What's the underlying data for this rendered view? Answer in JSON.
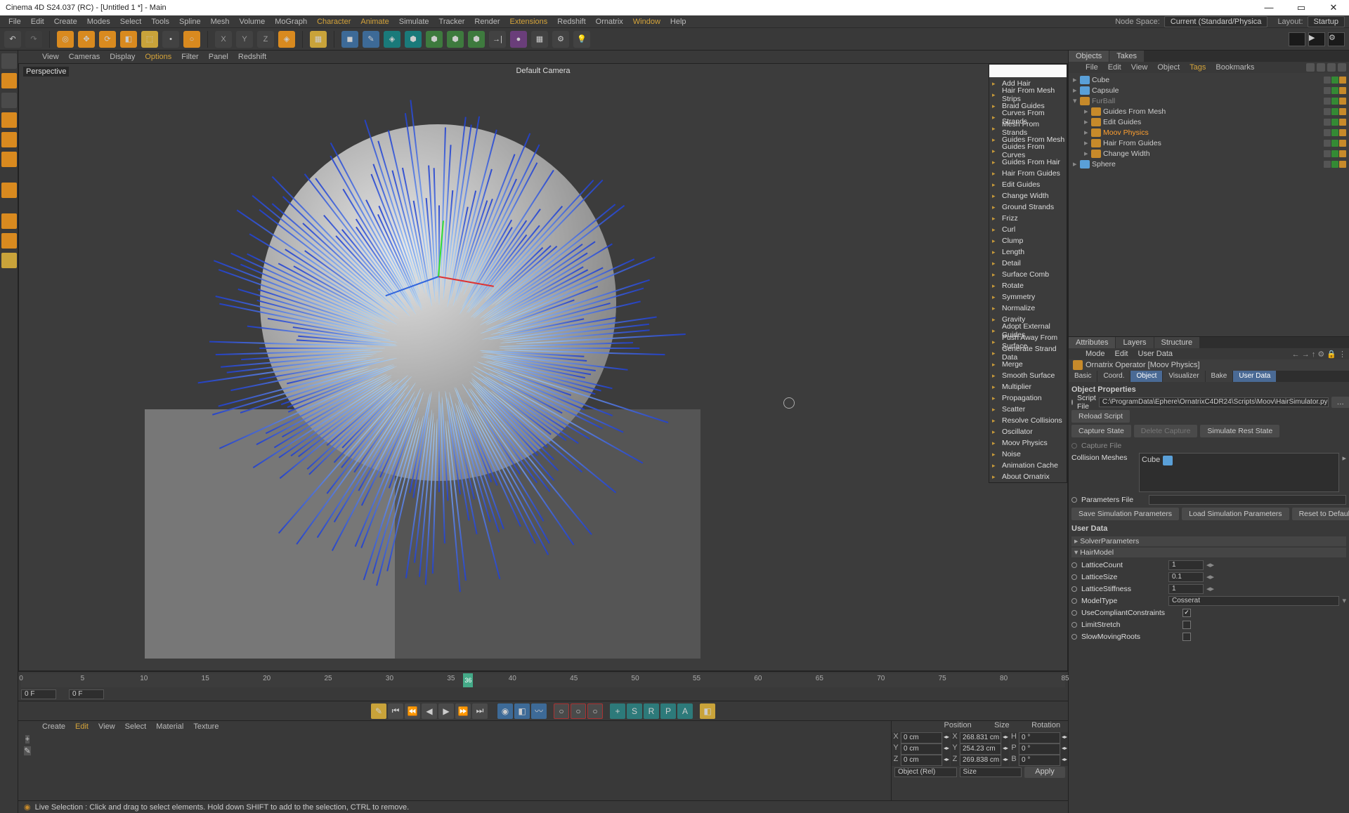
{
  "title": "Cinema 4D S24.037 (RC) - [Untitled 1 *] - Main",
  "menubar": [
    "File",
    "Edit",
    "Create",
    "Modes",
    "Select",
    "Tools",
    "Spline",
    "Mesh",
    "Volume",
    "MoGraph",
    "Character",
    "Animate",
    "Simulate",
    "Tracker",
    "Render",
    "Extensions",
    "Redshift",
    "Ornatrix",
    "Window",
    "Help"
  ],
  "menubar_hi1": [
    "Character",
    "Animate",
    "Extensions",
    "Window"
  ],
  "nodespace": {
    "label": "Node Space:",
    "value": "Current (Standard/Physica"
  },
  "layout": {
    "label": "Layout:",
    "value": "Startup"
  },
  "vp_menu": [
    "View",
    "Cameras",
    "Display",
    "Options",
    "Filter",
    "Panel",
    "Redshift"
  ],
  "vp_menu_hi": [
    "Options"
  ],
  "vp_label": "Perspective",
  "vp_camera": "Default Camera",
  "ctxmenu": [
    "Add Hair",
    "Hair From Mesh Strips",
    "Braid Guides",
    "Curves From Strands",
    "Mesh From Strands",
    "Guides From Mesh",
    "Guides From Curves",
    "Guides From Hair",
    "Hair From Guides",
    "Edit Guides",
    "Change Width",
    "Ground Strands",
    "Frizz",
    "Curl",
    "Clump",
    "Length",
    "Detail",
    "Surface Comb",
    "Rotate",
    "Symmetry",
    "Normalize",
    "Gravity",
    "Adopt External Guides",
    "Push Away From Surface",
    "Generate Strand Data",
    "Merge",
    "Smooth Surface",
    "Multiplier",
    "Propagation",
    "Scatter",
    "Resolve Collisions",
    "Oscillator",
    "Moov Physics",
    "Noise",
    "Animation Cache",
    "About Ornatrix"
  ],
  "timeline": {
    "ticks": [
      "0",
      "5",
      "10",
      "15",
      "20",
      "25",
      "30",
      "35",
      "40",
      "45",
      "50",
      "55",
      "60",
      "65",
      "70",
      "75",
      "80",
      "85"
    ],
    "current": "36",
    "start": "0 F",
    "cur": "0 F"
  },
  "mat_menu": [
    "Create",
    "Edit",
    "View",
    "Select",
    "Material",
    "Texture"
  ],
  "mat_menu_hi": [
    "Edit"
  ],
  "coords": {
    "hdr": [
      "Position",
      "Size",
      "Rotation"
    ],
    "rows": [
      {
        "ax": "X",
        "p": "0 cm",
        "s": "268.831 cm",
        "rl": "H",
        "r": "0 °"
      },
      {
        "ax": "Y",
        "p": "0 cm",
        "s": "254.23 cm",
        "rl": "P",
        "r": "0 °"
      },
      {
        "ax": "Z",
        "p": "0 cm",
        "s": "269.838 cm",
        "rl": "B",
        "r": "0 °"
      }
    ],
    "mode1": "Object (Rel)",
    "mode2": "Size",
    "apply": "Apply"
  },
  "status": "Live Selection : Click and drag to select elements. Hold down SHIFT to add to the selection, CTRL to remove.",
  "objmgr": {
    "tabs": [
      "Objects",
      "Takes"
    ],
    "menu": [
      "File",
      "Edit",
      "View",
      "Object",
      "Tags",
      "Bookmarks"
    ],
    "menu_hi": [
      "Tags"
    ],
    "tree": [
      {
        "name": "Cube",
        "ind": 0,
        "col": "#5aa0d8"
      },
      {
        "name": "Capsule",
        "ind": 0,
        "col": "#5aa0d8"
      },
      {
        "name": "FurBall",
        "ind": 0,
        "col": "#c78a2a",
        "sel": false,
        "exp": "▾",
        "fade": true
      },
      {
        "name": "Guides From Mesh",
        "ind": 1,
        "col": "#c78a2a"
      },
      {
        "name": "Edit Guides",
        "ind": 1,
        "col": "#c78a2a"
      },
      {
        "name": "Moov Physics",
        "ind": 1,
        "col": "#c78a2a",
        "sel": true
      },
      {
        "name": "Hair From Guides",
        "ind": 1,
        "col": "#c78a2a"
      },
      {
        "name": "Change Width",
        "ind": 1,
        "col": "#c78a2a"
      },
      {
        "name": "Sphere",
        "ind": 0,
        "col": "#5aa0d8"
      }
    ]
  },
  "attr": {
    "tabs": [
      "Attributes",
      "Layers",
      "Structure"
    ],
    "menu": [
      "Mode",
      "Edit",
      "User Data"
    ],
    "objtitle": "Ornatrix Operator [Moov Physics]",
    "subtabs": [
      "Basic",
      "Coord.",
      "Object",
      "Visualizer",
      "Bake",
      "User Data"
    ],
    "subtabs_active": [
      "Object",
      "User Data"
    ],
    "section": "Object Properties",
    "scriptfile_label": "Script File",
    "scriptfile": "C:\\ProgramData\\Ephere\\OrnatrixC4DR24\\Scripts\\Moov\\HairSimulator.py",
    "reload": "Reload Script",
    "capture": "Capture State",
    "delete": "Delete Capture",
    "simrest": "Simulate Rest State",
    "capturefile": "Capture File",
    "collmesh_label": "Collision Meshes",
    "collmesh_item": "Cube",
    "paramfile": "Parameters File",
    "savesim": "Save Simulation Parameters",
    "loadsim": "Load Simulation Parameters",
    "resetdef": "Reset to Default Values",
    "userdata": "User Data",
    "solver": "SolverParameters",
    "hairmodel": "HairModel",
    "params": [
      {
        "l": "LatticeCount",
        "v": "1"
      },
      {
        "l": "LatticeSize",
        "v": "0.1"
      },
      {
        "l": "LatticeStiffness",
        "v": "1"
      }
    ],
    "modeltype_l": "ModelType",
    "modeltype_v": "Cosserat",
    "checks": [
      {
        "l": "UseCompliantConstraints",
        "c": true
      },
      {
        "l": "LimitStretch",
        "c": false
      },
      {
        "l": "SlowMovingRoots",
        "c": false
      }
    ]
  }
}
